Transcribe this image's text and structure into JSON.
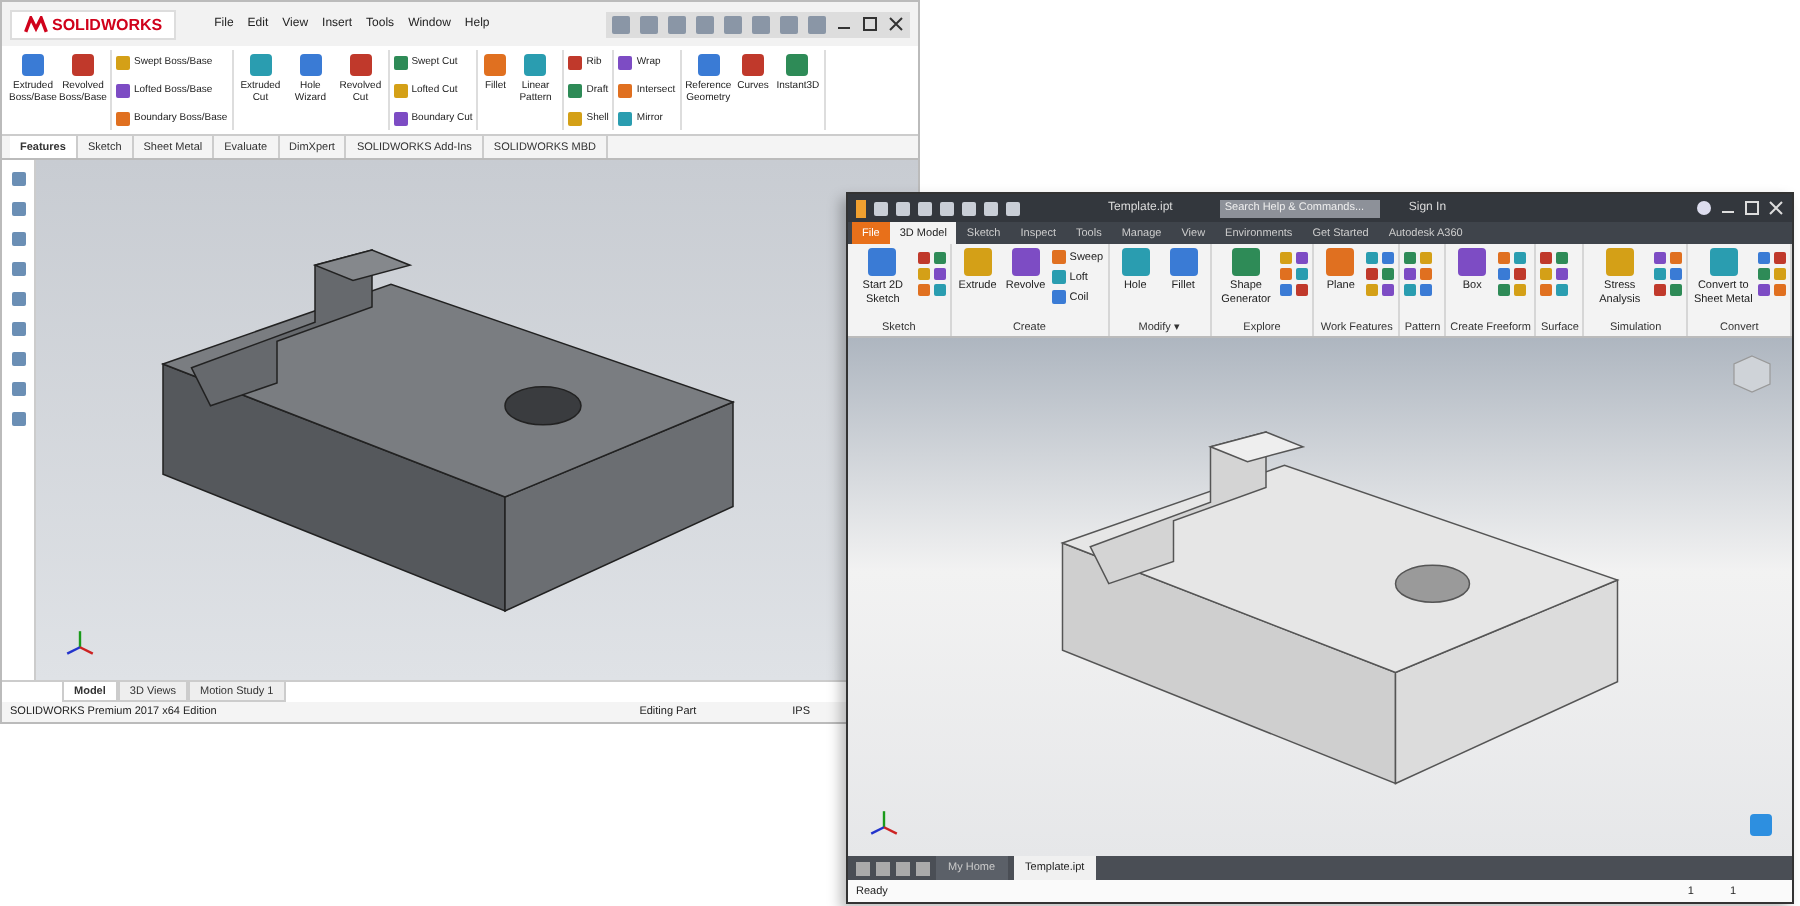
{
  "solidworks": {
    "logo": "SOLIDWORKS",
    "menu": [
      "File",
      "Edit",
      "View",
      "Insert",
      "Tools",
      "Window",
      "Help"
    ],
    "ribbon_groups": [
      {
        "items": [
          {
            "label": "Extruded Boss/Base",
            "kind": "large"
          },
          {
            "label": "Revolved Boss/Base",
            "kind": "large"
          }
        ]
      },
      {
        "items": [
          {
            "label": "Swept Boss/Base",
            "kind": "small"
          },
          {
            "label": "Lofted Boss/Base",
            "kind": "small"
          },
          {
            "label": "Boundary Boss/Base",
            "kind": "small"
          }
        ]
      },
      {
        "items": [
          {
            "label": "Extruded Cut",
            "kind": "large"
          },
          {
            "label": "Hole Wizard",
            "kind": "large"
          },
          {
            "label": "Revolved Cut",
            "kind": "large"
          }
        ]
      },
      {
        "items": [
          {
            "label": "Swept Cut",
            "kind": "small"
          },
          {
            "label": "Lofted Cut",
            "kind": "small"
          },
          {
            "label": "Boundary Cut",
            "kind": "small"
          }
        ]
      },
      {
        "items": [
          {
            "label": "Fillet",
            "kind": "large"
          },
          {
            "label": "Linear Pattern",
            "kind": "large"
          }
        ]
      },
      {
        "items": [
          {
            "label": "Rib",
            "kind": "small"
          },
          {
            "label": "Draft",
            "kind": "small"
          },
          {
            "label": "Shell",
            "kind": "small"
          }
        ]
      },
      {
        "items": [
          {
            "label": "Wrap",
            "kind": "small"
          },
          {
            "label": "Intersect",
            "kind": "small"
          },
          {
            "label": "Mirror",
            "kind": "small"
          }
        ]
      },
      {
        "items": [
          {
            "label": "Reference Geometry",
            "kind": "large"
          },
          {
            "label": "Curves",
            "kind": "large"
          },
          {
            "label": "Instant3D",
            "kind": "large"
          }
        ]
      }
    ],
    "tabs": [
      {
        "label": "Features",
        "selected": true
      },
      {
        "label": "Sketch",
        "selected": false
      },
      {
        "label": "Sheet Metal",
        "selected": false
      },
      {
        "label": "Evaluate",
        "selected": false
      },
      {
        "label": "DimXpert",
        "selected": false
      },
      {
        "label": "SOLIDWORKS Add-Ins",
        "selected": false
      },
      {
        "label": "SOLIDWORKS MBD",
        "selected": false
      }
    ],
    "bottom_tabs": [
      {
        "label": "Model",
        "selected": true
      },
      {
        "label": "3D Views",
        "selected": false
      },
      {
        "label": "Motion Study 1",
        "selected": false
      }
    ],
    "status_bar": [
      "SOLIDWORKS Premium 2017 x64 Edition",
      "Editing Part",
      "IPS"
    ]
  },
  "inventor": {
    "title": "Template.ipt",
    "search": {
      "placeholder": "Search Help & Commands..."
    },
    "sign_in": "Sign In",
    "tabs": [
      {
        "label": "File",
        "selected": false
      },
      {
        "label": "3D Model",
        "selected": true
      },
      {
        "label": "Sketch",
        "selected": false
      },
      {
        "label": "Inspect",
        "selected": false
      },
      {
        "label": "Tools",
        "selected": false
      },
      {
        "label": "Manage",
        "selected": false
      },
      {
        "label": "View",
        "selected": false
      },
      {
        "label": "Environments",
        "selected": false
      },
      {
        "label": "Get Started",
        "selected": false
      },
      {
        "label": "Autodesk A360",
        "selected": false
      }
    ],
    "panels": [
      {
        "label": "Sketch",
        "items": [
          {
            "label": "Start 2D Sketch",
            "kind": "large"
          }
        ]
      },
      {
        "label": "Create",
        "items": [
          {
            "label": "Extrude",
            "kind": "large"
          },
          {
            "label": "Revolve",
            "kind": "large"
          },
          {
            "label": "Sweep",
            "kind": "small"
          },
          {
            "label": "Loft",
            "kind": "small"
          },
          {
            "label": "Coil",
            "kind": "small"
          }
        ]
      },
      {
        "label": "Modify ▾",
        "items": [
          {
            "label": "Hole",
            "kind": "large"
          },
          {
            "label": "Fillet",
            "kind": "large"
          }
        ]
      },
      {
        "label": "Explore",
        "items": [
          {
            "label": "Shape Generator",
            "kind": "large"
          }
        ]
      },
      {
        "label": "Work Features",
        "items": [
          {
            "label": "Plane",
            "kind": "large"
          }
        ]
      },
      {
        "label": "Pattern"
      },
      {
        "label": "Create Freeform",
        "items": [
          {
            "label": "Box",
            "kind": "large"
          }
        ]
      },
      {
        "label": "Surface"
      },
      {
        "label": "Simulation",
        "items": [
          {
            "label": "Stress Analysis",
            "kind": "large"
          }
        ]
      },
      {
        "label": "Convert",
        "items": [
          {
            "label": "Convert to Sheet Metal",
            "kind": "large"
          }
        ]
      }
    ],
    "doc_tabs": [
      {
        "label": "My Home",
        "selected": false
      },
      {
        "label": "Template.ipt",
        "selected": true
      }
    ],
    "status_bar": [
      "Ready",
      "1",
      "1"
    ]
  }
}
